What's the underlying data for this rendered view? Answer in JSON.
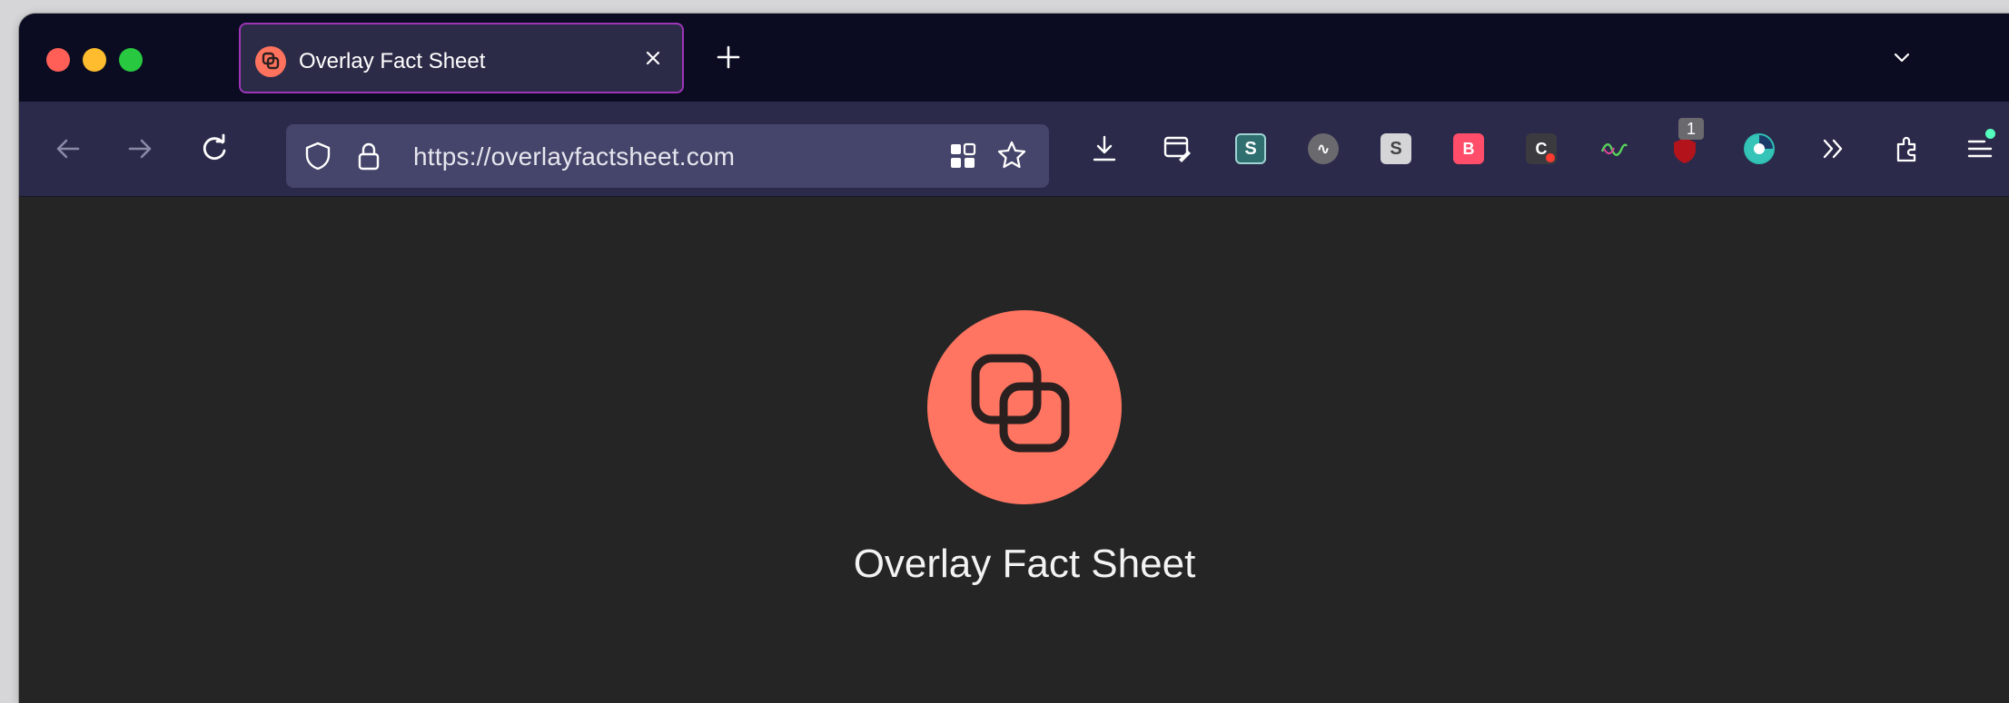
{
  "window": {
    "controls": [
      "close",
      "minimize",
      "zoom"
    ]
  },
  "tab": {
    "title": "Overlay Fact Sheet",
    "favicon_icon": "overlay-logo-icon",
    "close_icon": "close-icon"
  },
  "tabstrip": {
    "new_tab_icon": "plus-icon",
    "list_tabs_icon": "chevron-down-icon"
  },
  "toolbar": {
    "url": "https://overlayfactsheet.com",
    "extension_badge_count": "1"
  },
  "page": {
    "site_name": "Overlay Fact Sheet",
    "accent_color": "#ff7561",
    "background_color": "#252526"
  }
}
